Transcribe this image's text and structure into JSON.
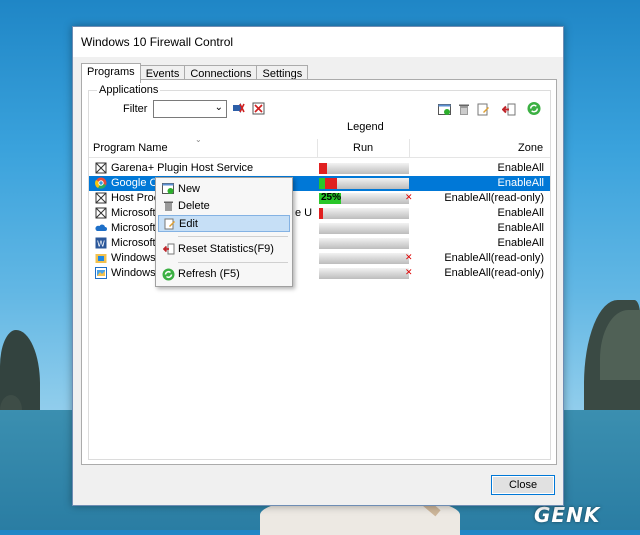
{
  "window": {
    "title": "Windows 10 Firewall Control"
  },
  "tabs": [
    {
      "label": "Programs",
      "active": true
    },
    {
      "label": "Events",
      "active": false
    },
    {
      "label": "Connections",
      "active": false
    },
    {
      "label": "Settings",
      "active": false
    }
  ],
  "applications": {
    "group_label": "Applications",
    "filter_label": "Filter",
    "filter_value": "",
    "legend_label": "Legend"
  },
  "table": {
    "headers": {
      "name": "Program Name",
      "run": "Run",
      "zone": "Zone"
    },
    "rows": [
      {
        "icon": "puzzle-icon",
        "name": "Garena+ Plugin Host Service",
        "zone": "EnableAll",
        "run": "red",
        "selected": false
      },
      {
        "icon": "chrome-icon",
        "name": "Google Ch",
        "zone": "EnableAll",
        "run": "green-red",
        "selected": true
      },
      {
        "icon": "puzzle-icon",
        "name": "Host Proce",
        "zone": "EnableAll(read-only)",
        "run": "25%",
        "selected": false
      },
      {
        "icon": "puzzle-icon",
        "name": "Microsoft",
        "name_tail": "e U",
        "zone": "EnableAll",
        "run": "red-small",
        "selected": false
      },
      {
        "icon": "onedrive-icon",
        "name": "Microsoft",
        "zone": "EnableAll",
        "run": "",
        "selected": false
      },
      {
        "icon": "word-icon",
        "name": "Microsoft",
        "zone": "EnableAll",
        "run": "",
        "selected": false
      },
      {
        "icon": "windows-folder-icon",
        "name": "Windows",
        "zone": "EnableAll(read-only)",
        "run": "",
        "selected": false
      },
      {
        "icon": "windows-app-icon",
        "name": "Windows",
        "zone": "EnableAll(read-only)",
        "run": "",
        "selected": false
      }
    ]
  },
  "context_menu": {
    "items": [
      {
        "icon": "new-icon",
        "label": "New"
      },
      {
        "icon": "trash-icon",
        "label": "Delete"
      },
      {
        "icon": "edit-icon",
        "label": "Edit",
        "highlighted": true
      },
      {
        "icon": "reset-icon",
        "label": "Reset Statistics(F9)"
      },
      {
        "icon": "refresh-icon",
        "label": "Refresh (F5)"
      }
    ]
  },
  "footer": {
    "close_label": "Close"
  },
  "watermark": "GENK",
  "colors": {
    "selection": "#0078d7",
    "highlight": "#c6dff6",
    "run_red": "#e02020",
    "run_green": "#29c629"
  }
}
